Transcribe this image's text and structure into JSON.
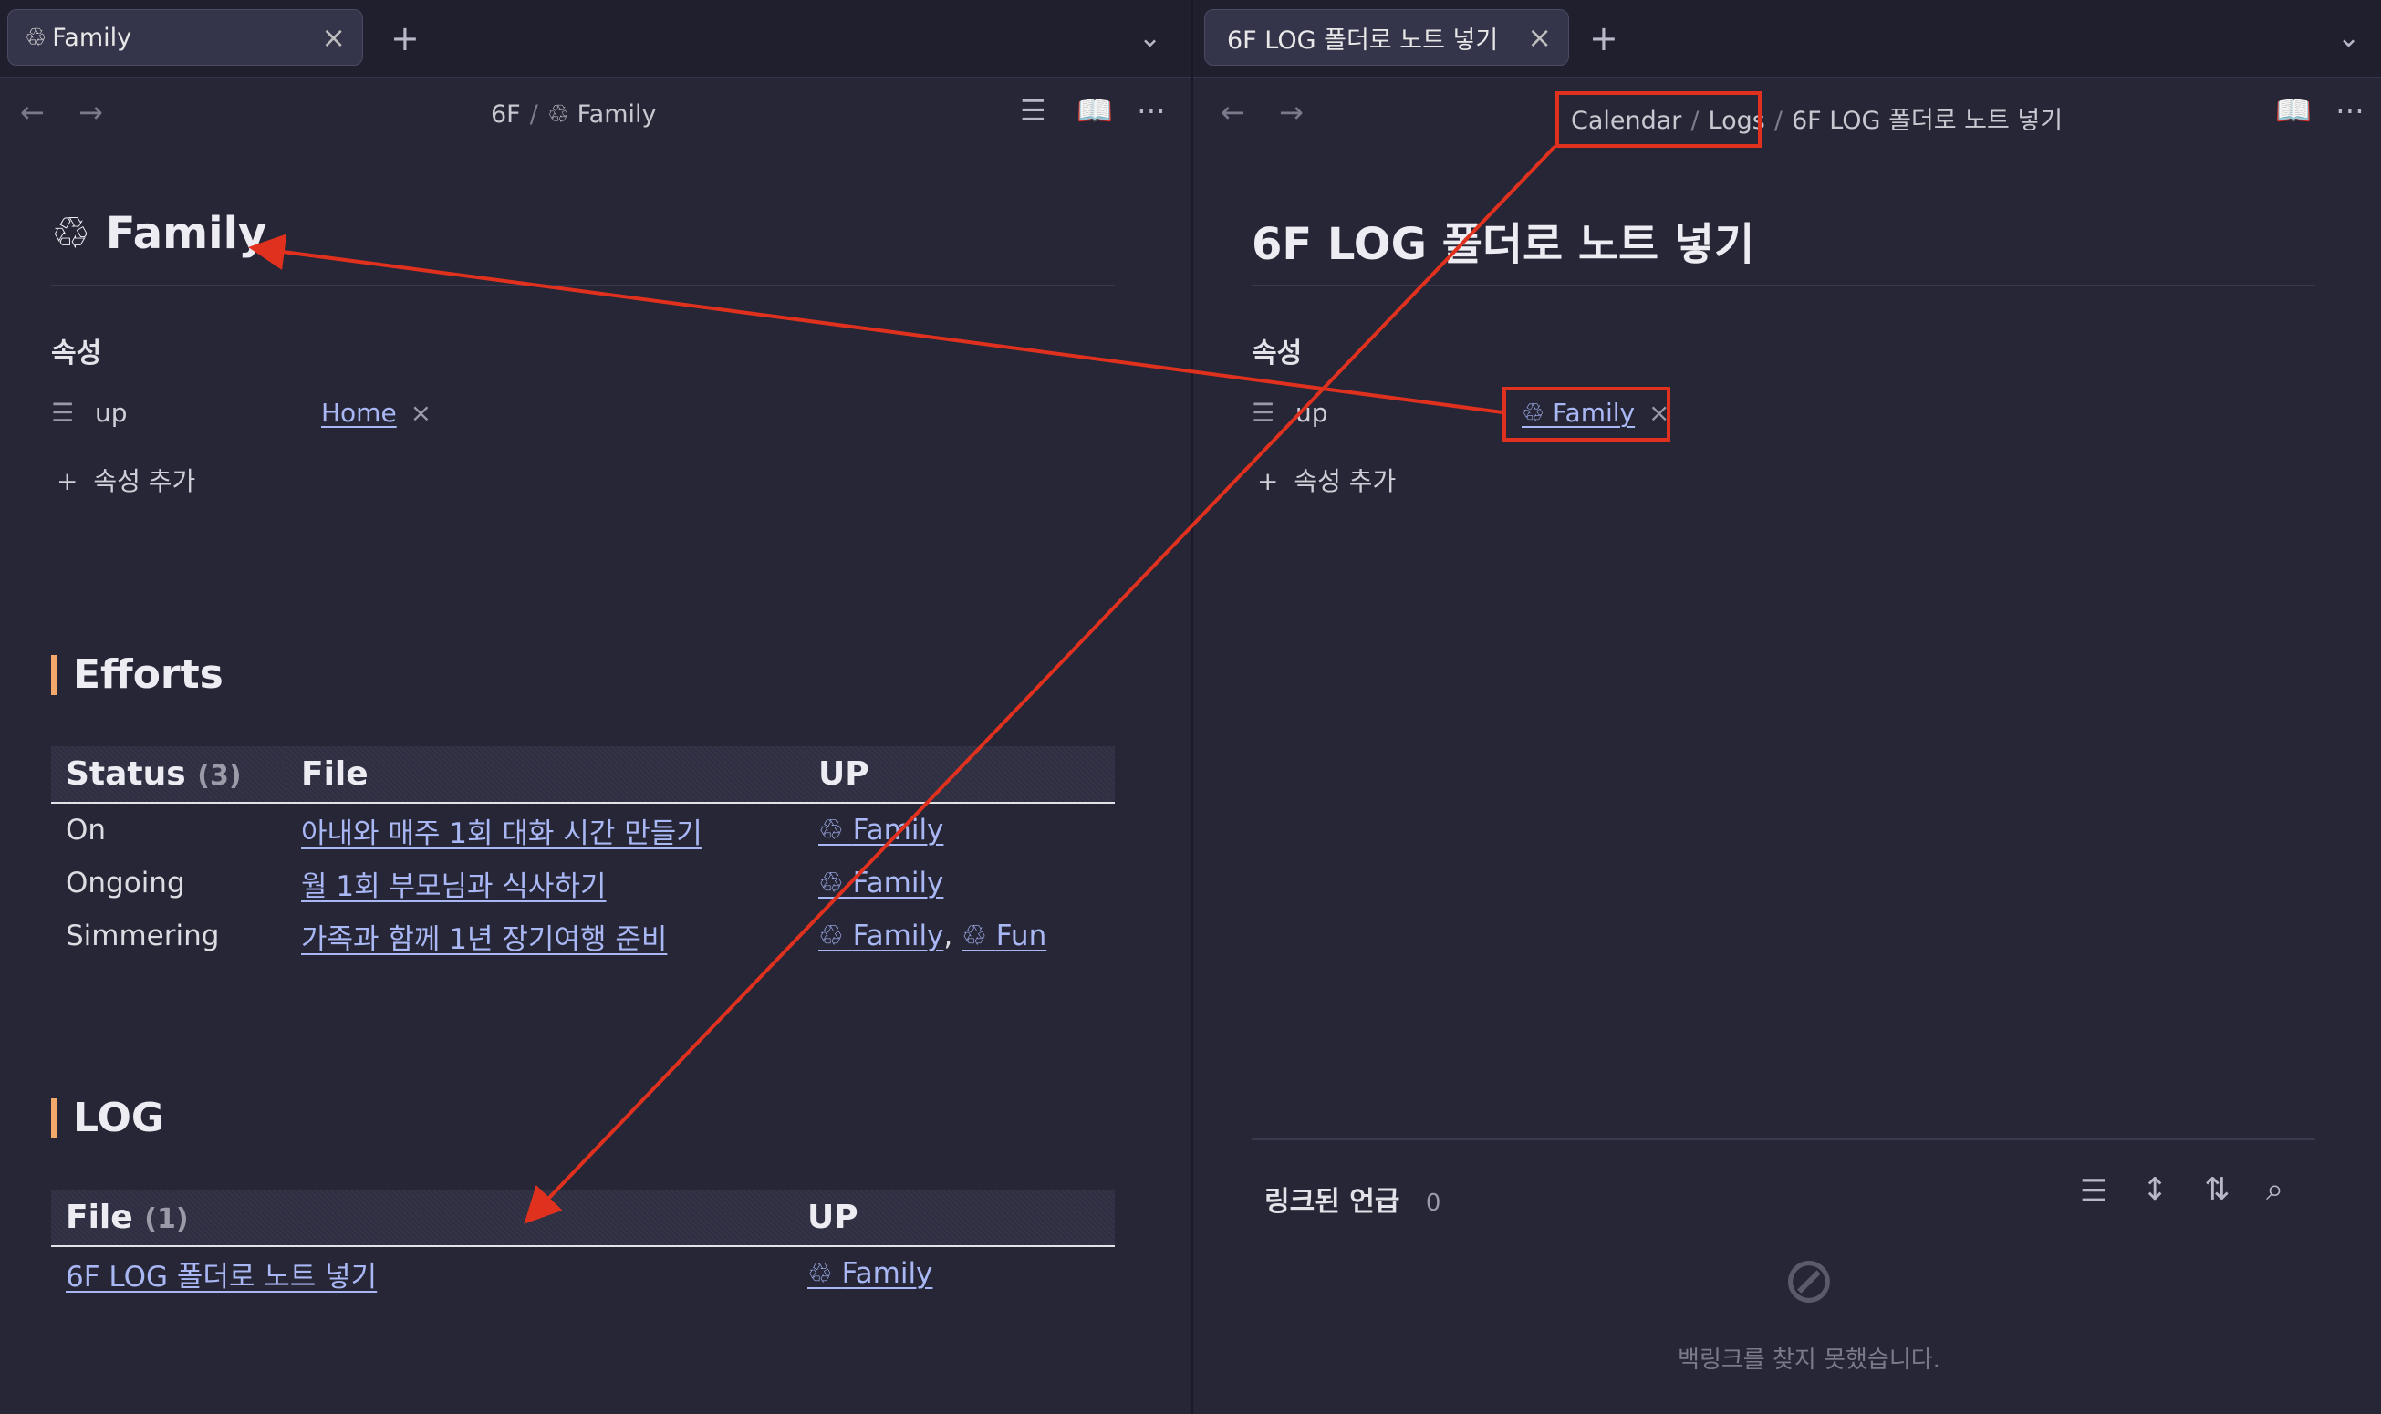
{
  "left": {
    "tab": {
      "icon": "recycle-icon",
      "title": "Family"
    },
    "breadcrumb": [
      "6F",
      "Family"
    ],
    "title": "Family",
    "properties_heading": "속성",
    "property": {
      "key": "up",
      "value": "Home"
    },
    "add_property": "속성 추가",
    "efforts": {
      "heading": "Efforts",
      "columns": {
        "status": "Status",
        "status_count": "(3)",
        "file": "File",
        "up": "UP"
      },
      "rows": [
        {
          "status": "On",
          "file": "아내와 매주 1회 대화 시간 만들기",
          "up": "Family"
        },
        {
          "status": "Ongoing",
          "file": "월 1회 부모님과 식사하기",
          "up": "Family"
        },
        {
          "status": "Simmering",
          "file": "가족과 함께 1년 장기여행 준비",
          "up": "Family",
          "up2": "Fun"
        }
      ]
    },
    "log": {
      "heading": "LOG",
      "columns": {
        "file": "File",
        "file_count": "(1)",
        "up": "UP"
      },
      "rows": [
        {
          "file": "6F LOG 폴더로 노트 넣기",
          "up": "Family"
        }
      ]
    }
  },
  "right": {
    "tab": {
      "title": "6F LOG 폴더로 노트 넣기"
    },
    "breadcrumb": [
      "Calendar",
      "Logs",
      "6F LOG 폴더로 노트 넣기"
    ],
    "title": "6F LOG 폴더로 노트 넣기",
    "properties_heading": "속성",
    "property": {
      "key": "up",
      "value": "Family"
    },
    "add_property": "속성 추가",
    "backlinks": {
      "heading": "링크된 언급",
      "count": "0",
      "empty_text": "백링크를 찾지 못했습니다."
    }
  },
  "sep": "/",
  "colors": {
    "accent_annotation": "#e0311f",
    "link": "#a9b8f5",
    "heading_bar": "#f4a86b",
    "background": "#262636"
  }
}
